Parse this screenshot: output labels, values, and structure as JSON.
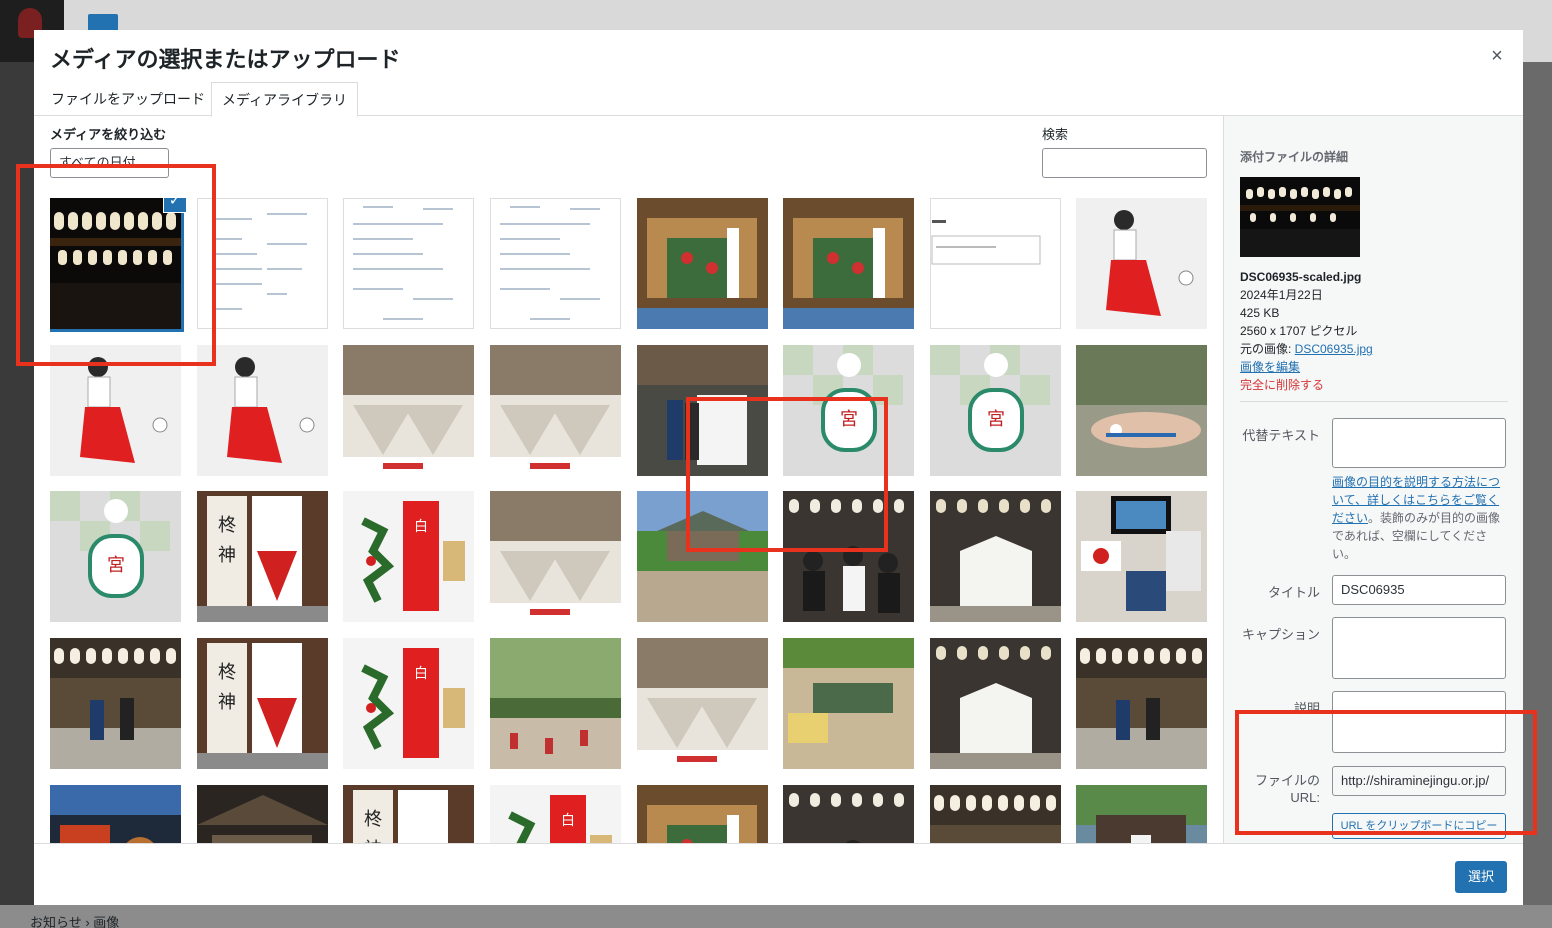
{
  "background": {
    "breadcrumb": "お知らせ  ›  画像"
  },
  "modal": {
    "title": "メディアの選択またはアップロード",
    "close_icon": "×",
    "tabs": [
      {
        "label": "ファイルをアップロード"
      },
      {
        "label": "メディアライブラリ"
      }
    ],
    "filter_label": "メディアを絞り込む",
    "date_filter_value": "すべての日付",
    "search_label": "検索",
    "select_button": "選択"
  },
  "details": {
    "title": "添付ファイルの詳細",
    "filename": "DSC06935-scaled.jpg",
    "date": "2024年1月22日",
    "size": "425 KB",
    "dimensions": "2560 x 1707 ピクセル",
    "original_label": "元の画像: ",
    "original_link": "DSC06935.jpg",
    "edit_link": "画像を編集",
    "delete_link": "完全に削除する",
    "alt_label": "代替テキスト",
    "alt_help_link": "画像の目的を説明する方法について、詳しくはこちらをご覧ください",
    "alt_help_text": "。装飾のみが目的の画像であれば、空欄にしてください。",
    "title_label": "タイトル",
    "title_value": "DSC06935",
    "caption_label": "キャプション",
    "description_label": "説明",
    "url_label_1": "ファイルの",
    "url_label_2": "URL:",
    "url_value": "http://shiraminejingu.or.jp/",
    "copy_button": "URL をクリップボードにコピー"
  },
  "media_items": [
    "lantern-shrine-night",
    "document-scan",
    "document-form",
    "document-form",
    "shrine-amulet-stall",
    "shrine-amulet-stall",
    "document-screenshot",
    "miko-illustration",
    "miko-illustration",
    "miko-illustration",
    "amulet-boxes",
    "amulet-boxes",
    "ema-board-visitors",
    "amulet-charm",
    "amulet-charm",
    "wrist-bracelet",
    "amulet-charm",
    "talisman-sign",
    "white-amulet-paper",
    "amulet-boxes",
    "shrine-building",
    "students-group",
    "ema-board",
    "flag-tv-room",
    "lantern-shrine-visitors",
    "talisman-sign",
    "white-amulet-paper",
    "festival-dancers",
    "amulet-boxes",
    "sand-garden",
    "ema-board",
    "lantern-shrine-visitors",
    "display-shelf",
    "shrine-interior",
    "talisman-sign",
    "white-amulet-paper",
    "shrine-amulet-stall",
    "students-group",
    "lantern-shrine-visitors",
    "shrine-entrance"
  ],
  "selected_index": 0
}
